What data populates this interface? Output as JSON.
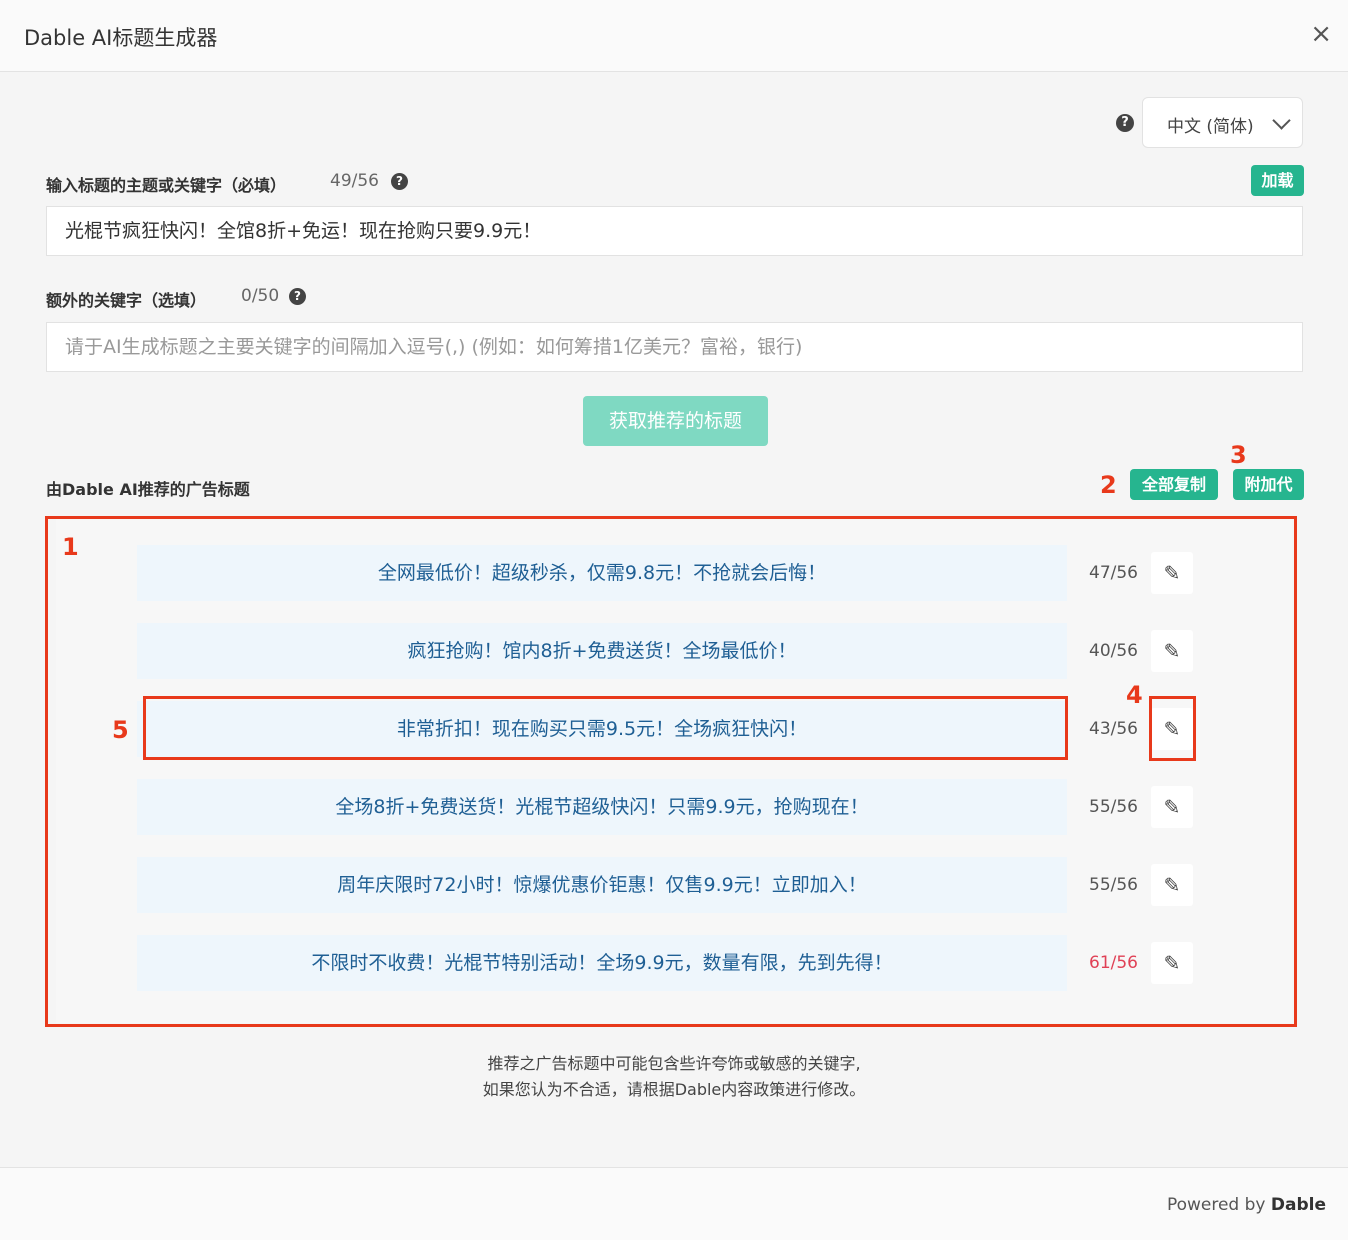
{
  "header": {
    "title": "Dable AI标题生成器",
    "close_icon": "×"
  },
  "language": {
    "help_icon": "?",
    "selected": "中文 (简体)"
  },
  "topic": {
    "label": "输入标题的主题或关键字（必填）",
    "count": "49/56",
    "help_icon": "?",
    "load_label": "加载",
    "value": "光棍节疯狂快闪！全馆8折+免运！现在抢购只要9.9元！"
  },
  "extra": {
    "label": "额外的关键字（选填）",
    "count": "0/50",
    "help_icon": "?",
    "placeholder": "请于AI生成标题之主要关键字的间隔加入逗号(,) (例如：如何筹措1亿美元？富裕，银行)"
  },
  "fetch_label": "获取推荐的标题",
  "results": {
    "label": "由Dable AI推荐的广告标题",
    "copy_all_label": "全部复制",
    "append_label": "附加代",
    "items": [
      {
        "text": "全网最低价！超级秒杀，仅需9.8元！不抢就会后悔！",
        "count": "47/56"
      },
      {
        "text": "疯狂抢购！馆内8折+免费送货！全场最低价！",
        "count": "40/56"
      },
      {
        "text": "非常折扣！现在购买只需9.5元！全场疯狂快闪！",
        "count": "43/56"
      },
      {
        "text": "全场8折+免费送货！光棍节超级快闪！只需9.9元，抢购现在！",
        "count": "55/56"
      },
      {
        "text": "周年庆限时72小时！惊爆优惠价钜惠！仅售9.9元！立即加入！",
        "count": "55/56"
      },
      {
        "text": "不限时不收费！光棍节特别活动！全场9.9元，数量有限，先到先得！",
        "count": "61/56"
      }
    ]
  },
  "annotations": [
    "1",
    "2",
    "3",
    "4",
    "5"
  ],
  "annotation_color": "#e8391b",
  "accent_color": "#26b58f",
  "note": {
    "line1": "推荐之广告标题中可能包含些许夸饰或敏感的关键字,",
    "line2": "如果您认为不合适，请根据Dable内容政策进行修改。"
  },
  "footer": {
    "powered_by": "Powered by",
    "brand": "Dable"
  }
}
